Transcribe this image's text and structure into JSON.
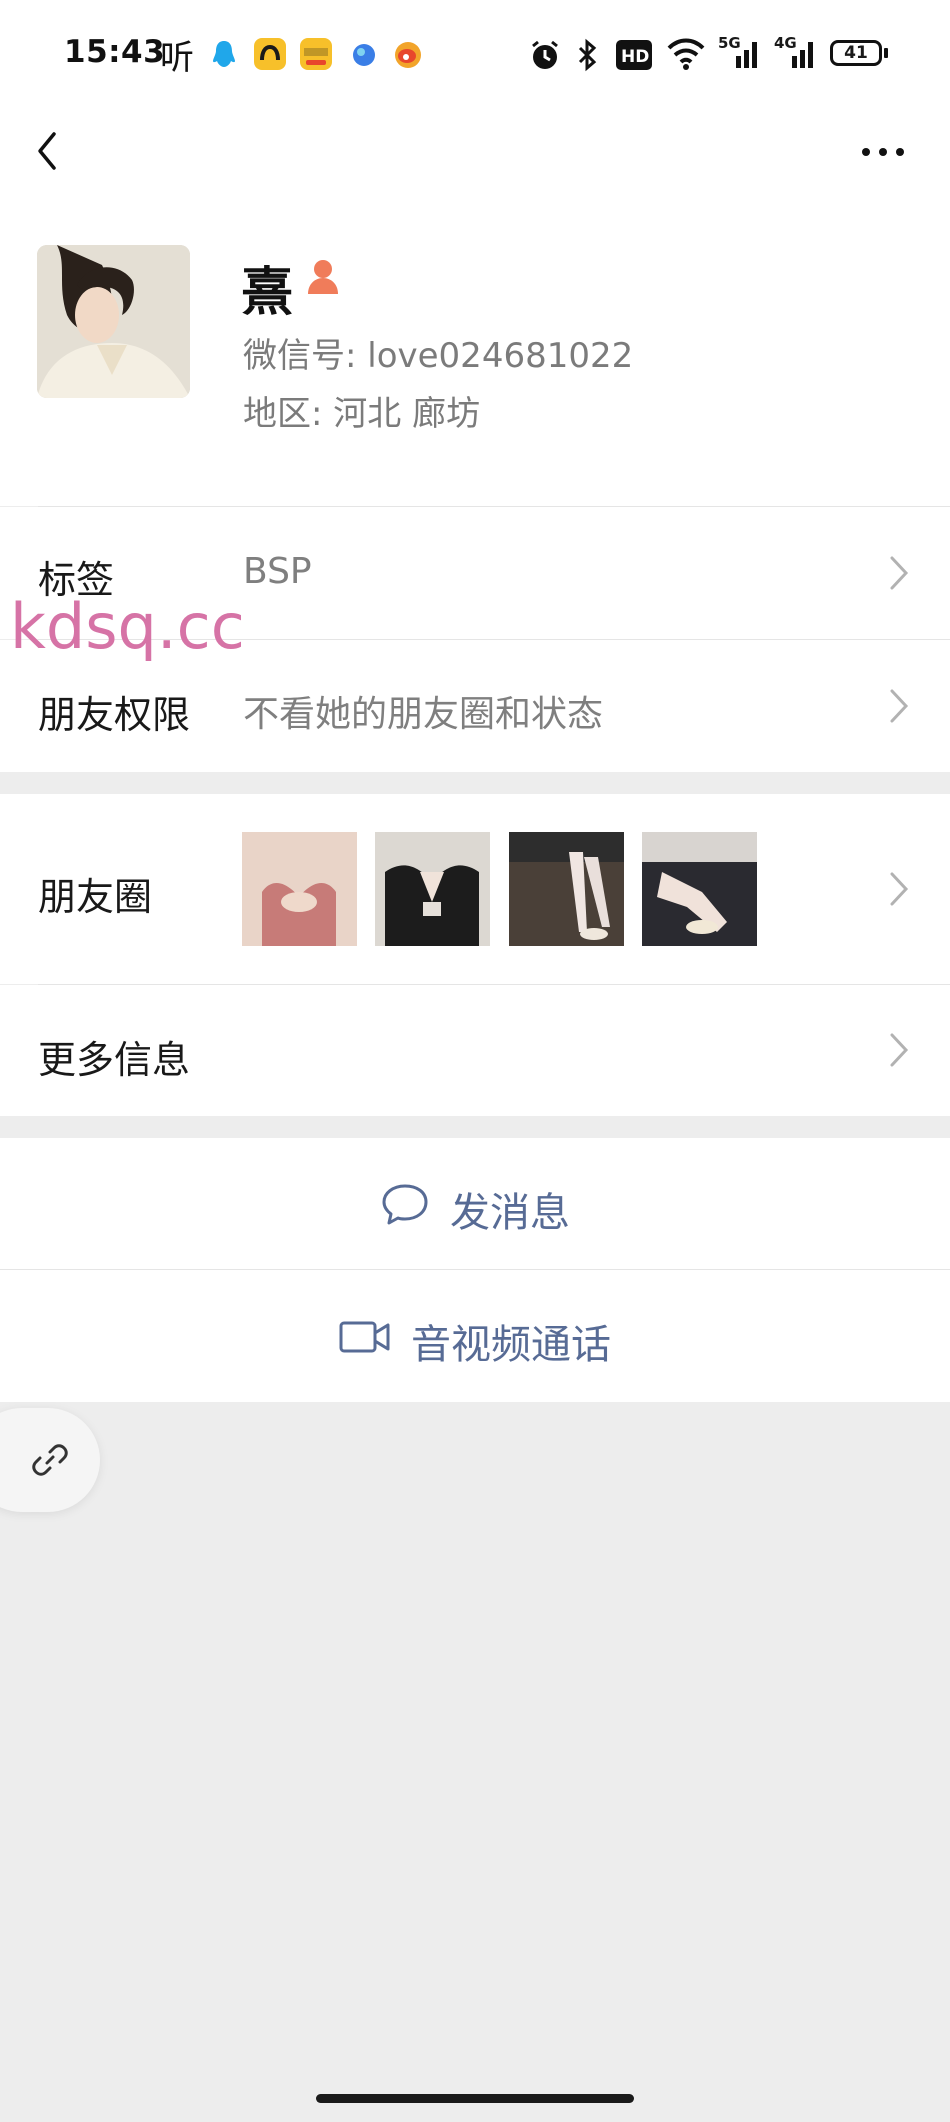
{
  "status_bar": {
    "time": "15:43",
    "ting_glyph": "听",
    "app_icons": [
      {
        "name": "qq-icon",
        "color": "#20a7ea"
      },
      {
        "name": "quark-icon",
        "color": "#f7c02a"
      },
      {
        "name": "meituan-icon",
        "color": "#f7c02a"
      },
      {
        "name": "chrome-like-icon",
        "color": "#3a7ee6"
      },
      {
        "name": "weibo-icon",
        "color": "#f2a42a"
      }
    ],
    "net_5g": "5G",
    "net_4g": "4G",
    "battery_level": "41"
  },
  "nav": {
    "back_icon": "chevron-left-icon",
    "more_icon": "more-dots-icon"
  },
  "profile": {
    "nickname": "熹",
    "wechat_id": "微信号: love024681022",
    "region": "地区: 河北  廊坊"
  },
  "rows": {
    "tags_label": "标签",
    "tags_value": "BSP",
    "permission_label": "朋友权限",
    "permission_value": "不看她的朋友圈和状态",
    "moments_label": "朋友圈",
    "more_info_label": "更多信息"
  },
  "actions": {
    "send_message": "发消息",
    "video_call": "音视频通话"
  },
  "watermark": "kdsq.cc",
  "colors": {
    "link_blue": "#576b95",
    "watermark_pink": "#d673a6",
    "badge_orange": "#f07c5a"
  }
}
